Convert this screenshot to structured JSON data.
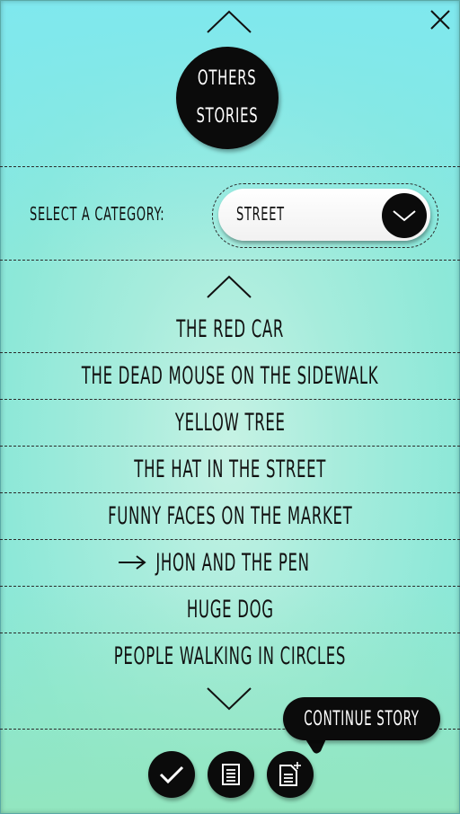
{
  "header": {
    "title_lines": [
      "OTHERS",
      "STORIES"
    ]
  },
  "category": {
    "label": "SELECT A CATEGORY:",
    "selected": "STREET"
  },
  "stories": [
    {
      "title": "THE RED CAR"
    },
    {
      "title": "THE DEAD MOUSE ON THE SIDEWALK"
    },
    {
      "title": "YELLOW TREE"
    },
    {
      "title": "THE HAT IN THE STREET"
    },
    {
      "title": "FUNNY FACES ON THE MARKET"
    },
    {
      "title": "JHON AND THE PEN",
      "selected": true
    },
    {
      "title": "HUGE DOG"
    },
    {
      "title": "PEOPLE WALKING IN CIRCLES"
    }
  ],
  "tooltip": {
    "label": "CONTINUE STORY"
  },
  "icons": {
    "close": "close-icon",
    "scroll_up": "chevron-up-icon",
    "scroll_down": "chevron-down-icon",
    "dropdown": "chevron-down-icon",
    "selected_marker": "arrow-right-icon",
    "confirm": "check-icon",
    "read": "document-icon",
    "new": "new-document-icon"
  },
  "colors": {
    "accent": "#0b0b0b",
    "background_top": "#84e6e0",
    "background_bottom": "#92e6bf",
    "pill": "#ffffff"
  }
}
